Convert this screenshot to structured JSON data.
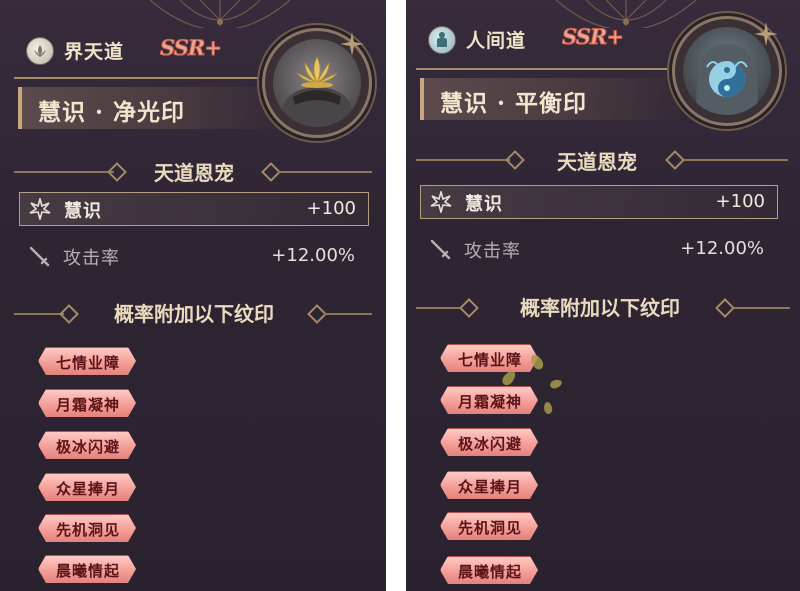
{
  "colors": {
    "panel_bg": "#2e2533",
    "gold": "#c9a77d",
    "tag_fill": "#f49d97",
    "tag_text": "#5a1418",
    "rarity": "#f0a58f"
  },
  "panels": [
    {
      "type_icon": "lotus-disc-icon",
      "type_name": "界天道",
      "rarity": "SSR+",
      "title": "慧识 · 净光印",
      "portrait_icon": "lotus-mask-portrait-icon",
      "section1_title": "天道恩宠",
      "stats": [
        {
          "icon": "star-burst-icon",
          "label": "慧识",
          "value": "+100"
        },
        {
          "icon": "sword-icon",
          "label": "攻击率",
          "value": "+12.00%"
        }
      ],
      "section2_title": "概率附加以下纹印",
      "tags": [
        "七情业障",
        "月霜凝神",
        "极冰闪避",
        "众星捧月",
        "先机洞见",
        "晨曦情起"
      ]
    },
    {
      "type_icon": "human-disc-icon",
      "type_name": "人间道",
      "rarity": "SSR+",
      "title": "慧识 · 平衡印",
      "portrait_icon": "yin-yang-torso-portrait-icon",
      "section1_title": "天道恩宠",
      "stats": [
        {
          "icon": "star-burst-icon",
          "label": "慧识",
          "value": "+100"
        },
        {
          "icon": "sword-icon",
          "label": "攻击率",
          "value": "+12.00%"
        }
      ],
      "section2_title": "概率附加以下纹印",
      "tags": [
        "七情业障",
        "月霜凝神",
        "极冰闪避",
        "众星捧月",
        "先机洞见",
        "晨曦情起"
      ]
    }
  ]
}
